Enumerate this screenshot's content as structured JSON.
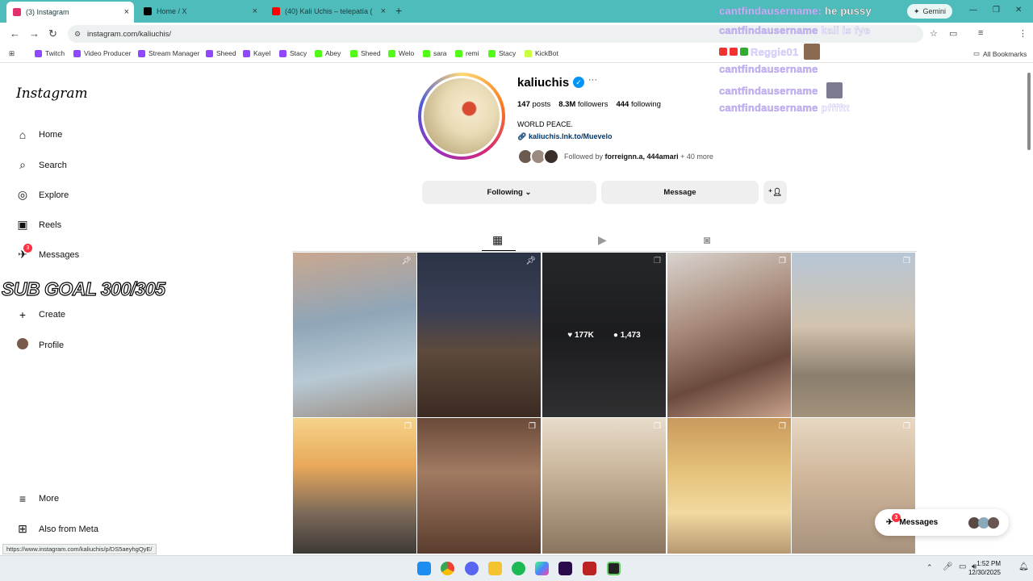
{
  "browser": {
    "tabs": [
      {
        "title": "(3) Instagram",
        "active": true,
        "color": "#e1306c"
      },
      {
        "title": "Home / X",
        "active": false,
        "color": "#000000"
      },
      {
        "title": "(40) Kali Uchis – telepatía (",
        "active": false,
        "color": "#ff0000"
      }
    ],
    "gemini_label": "Gemini",
    "url": "instagram.com/kaliuchis/",
    "all_bookmarks": "All Bookmarks",
    "bookmarks": [
      "Twitch",
      "Video Producer",
      "Stream Manager",
      "Sheed",
      "Kayel",
      "Stacy",
      "Abey",
      "Sheed",
      "Welo",
      "sara",
      "remi",
      "Stacy",
      "KickBot"
    ]
  },
  "overlay": {
    "chat": [
      {
        "user": "cantfindausername:",
        "msg": "he pussy"
      },
      {
        "user": "cantfindausername",
        "msg": "kali is fye"
      },
      {
        "user": "Reggie01",
        "msg": ""
      },
      {
        "user": "cantfindausername",
        "msg": ""
      },
      {
        "user": "cantfindausername",
        "msg": ""
      },
      {
        "user": "cantfindausername",
        "msg": "pfffftt"
      }
    ],
    "sub_goal": "SUB GOAL 300/305"
  },
  "sidebar": {
    "logo": "Instagram",
    "items": [
      {
        "label": "Home",
        "icon": "home-icon",
        "glyph": "⌂"
      },
      {
        "label": "Search",
        "icon": "search-icon",
        "glyph": "⌕"
      },
      {
        "label": "Explore",
        "icon": "compass-icon",
        "glyph": "◎"
      },
      {
        "label": "Reels",
        "icon": "reels-icon",
        "glyph": "▣"
      },
      {
        "label": "Messages",
        "icon": "messenger-icon",
        "glyph": "✈",
        "badge": "3"
      },
      {
        "label": "Create",
        "icon": "plus-icon",
        "glyph": "+"
      },
      {
        "label": "Profile",
        "icon": "avatar-icon",
        "glyph": "●"
      }
    ],
    "more": "More",
    "also_from_meta": "Also from Meta"
  },
  "profile": {
    "username": "kaliuchis",
    "posts": "147",
    "posts_label": "posts",
    "followers": "8.3M",
    "followers_label": "followers",
    "following": "444",
    "following_label": "following",
    "bio": "WORLD PEACE.",
    "link": "kaliuchis.lnk.to/Muevelo",
    "followed_by_prefix": "Followed by",
    "followed_by_names": "forreignn.a, 444amari",
    "followed_by_more": "+ 40 more",
    "following_btn": "Following",
    "message_btn": "Message"
  },
  "hover_post": {
    "likes": "177K",
    "comments": "1,473"
  },
  "posts": [
    {
      "bg": "linear-gradient(170deg,#c9a78f 0%,#8fa6b8 40%,#b7c9d4 70%,#9c8f86 100%)",
      "pinned": true
    },
    {
      "bg": "linear-gradient(180deg,#2b3346 0%,#3a3f55 35%,#5d4a3c 60%,#3a2a22 100%)",
      "pinned": true
    },
    {
      "bg": "linear-gradient(180deg,#3a3c40 0%,#2b2c2f 50%,#4a4a4d 100%)",
      "pinned": false
    },
    {
      "bg": "linear-gradient(160deg,#d9d4cf 0%,#a88a7a 40%,#6b4a3e 70%,#c7a18b 100%)",
      "pinned": false
    },
    {
      "bg": "linear-gradient(180deg,#b7c6d6 0%,#d2c3ae 45%,#8b7e6d 75%,#a3927c 100%)",
      "pinned": false
    },
    {
      "bg": "linear-gradient(180deg,#f5d38a 0%,#e9a95a 35%,#7c6a5a 70%,#3d3a35 100%)",
      "pinned": false
    },
    {
      "bg": "linear-gradient(180deg,#6b4a3a 0%,#a17b62 40%,#5a3c2e 100%)",
      "pinned": false
    },
    {
      "bg": "linear-gradient(180deg,#e8dccb 0%,#c9b59a 40%,#8a7560 100%)",
      "pinned": false
    },
    {
      "bg": "linear-gradient(180deg,#c99a5c 0%,#e6c27b 40%,#f1d9a0 70%,#b89872 100%)",
      "pinned": false
    },
    {
      "bg": "linear-gradient(180deg,#e7d7c2 0%,#cfb69a 45%,#a8927e 100%)",
      "pinned": false
    }
  ],
  "messages_pill": {
    "label": "Messages",
    "badge": "3"
  },
  "status_url": "https://www.instagram.com/kaliuchis/p/DS5aeyhgQyE/",
  "clock": {
    "time": "1:52 PM",
    "date": "12/30/2025"
  },
  "colors": {
    "accent": "#0095f6",
    "tabbar": "#4fbcbc",
    "chat": "#c9b7f5"
  }
}
